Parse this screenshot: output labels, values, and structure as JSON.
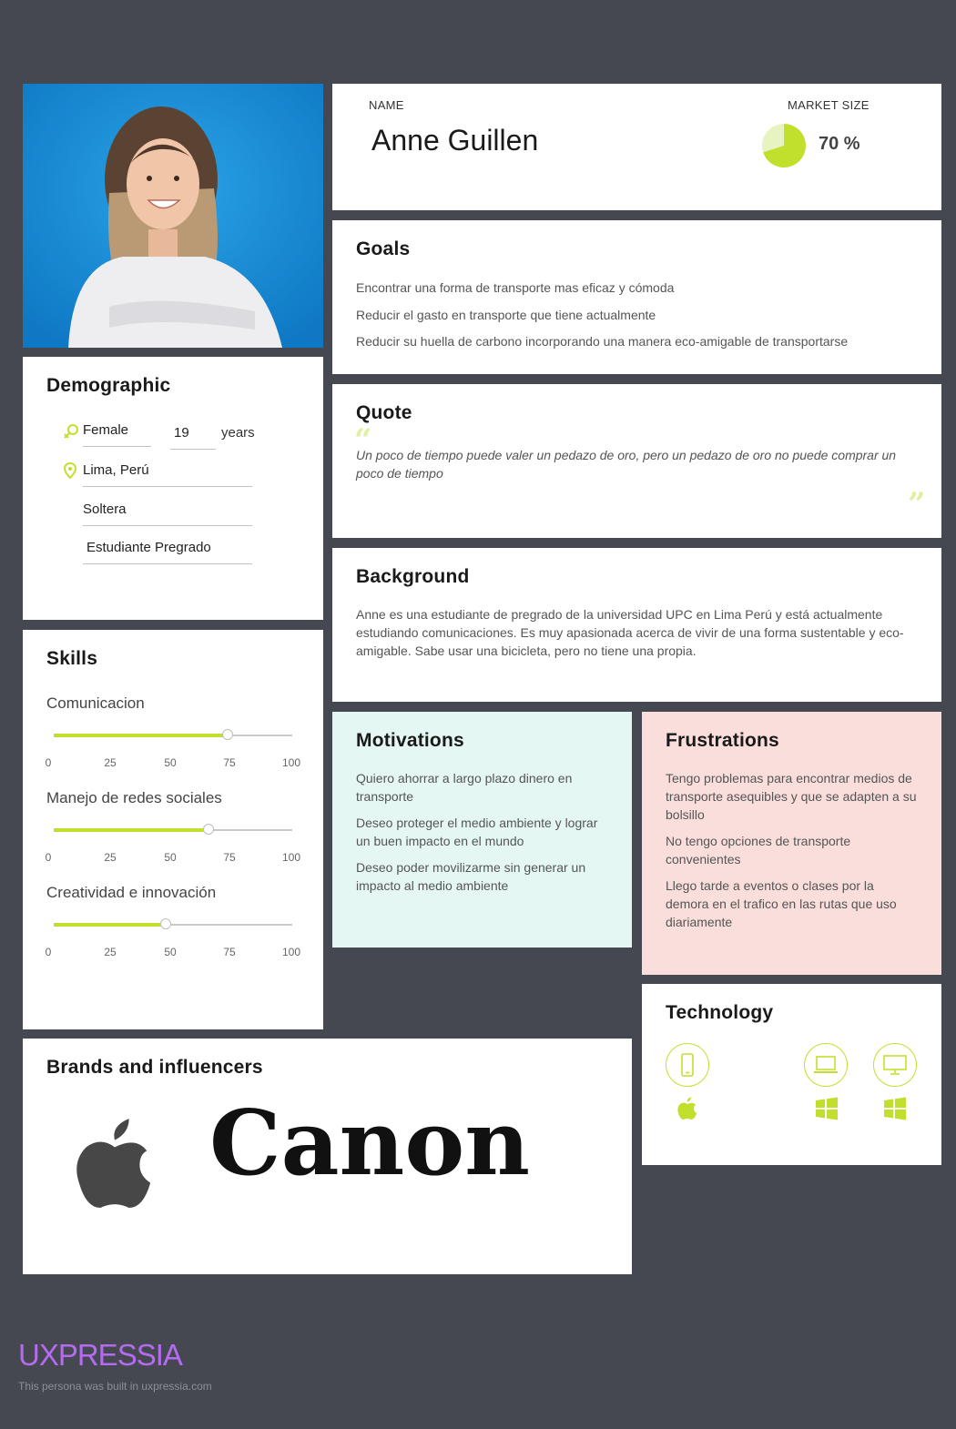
{
  "profile": {
    "name_label": "NAME",
    "name": "Anne Guillen",
    "market_label": "MARKET SIZE",
    "market_value": "70 %",
    "market_fraction": 0.7
  },
  "goals": {
    "title": "Goals",
    "items": [
      "Encontrar una forma de transporte mas eficaz y cómoda",
      "Reducir el gasto en transporte que tiene actualmente",
      "Reducir su huella de carbono incorporando una manera eco-amigable de transportarse"
    ]
  },
  "demographic": {
    "title": "Demographic",
    "gender": "Female",
    "age": "19",
    "age_unit": "years",
    "location": "Lima, Perú",
    "status": "Soltera",
    "occupation": "Estudiante Pregrado"
  },
  "quote": {
    "title": "Quote",
    "text": "Un poco de tiempo puede valer un pedazo de oro, pero un pedazo de oro no puede comprar un poco de tiempo"
  },
  "background": {
    "title": "Background",
    "text": "Anne es una estudiante de pregrado de la universidad UPC en Lima Perú y está actualmente estudiando comunicaciones. Es muy apasionada acerca de vivir de una forma sustentable y eco-amigable. Sabe usar una bicicleta, pero no tiene una propia."
  },
  "skills": {
    "title": "Skills",
    "ticks": [
      "0",
      "25",
      "50",
      "75",
      "100"
    ],
    "items": [
      {
        "label": "Comunicacion",
        "value": 73
      },
      {
        "label": "Manejo de redes sociales",
        "value": 65
      },
      {
        "label": "Creatividad e innovación",
        "value": 47
      }
    ]
  },
  "motivations": {
    "title": "Motivations",
    "items": [
      "Quiero ahorrar a largo plazo dinero en transporte",
      "Deseo proteger el medio ambiente y lograr un buen impacto en el mundo",
      "Deseo poder movilizarme sin generar un impacto al medio ambiente"
    ]
  },
  "frustrations": {
    "title": "Frustrations",
    "items": [
      "Tengo problemas para encontrar medios de transporte asequibles y que se adapten a su bolsillo",
      "No tengo opciones de transporte convenientes",
      "Llego tarde a eventos o clases por la demora en el trafico en las rutas que uso diariamente"
    ]
  },
  "technology": {
    "title": "Technology",
    "devices": [
      {
        "device": "smartphone-icon",
        "os": "apple-icon"
      },
      {
        "device": "laptop-icon",
        "os": "windows-icon"
      },
      {
        "device": "desktop-icon",
        "os": "windows-icon"
      }
    ]
  },
  "brands": {
    "title": "Brands and influencers",
    "logos": [
      "apple-logo",
      "Canon"
    ]
  },
  "footer": {
    "logo": "UXPRESSIA",
    "note": "This persona was built in uxpressia.com"
  },
  "colors": {
    "background": "#454851",
    "accent": "#c1e02d",
    "motivations_bg": "#e5f7f3",
    "frustrations_bg": "#f9dedb",
    "brand_purple": "#b46bf0"
  }
}
